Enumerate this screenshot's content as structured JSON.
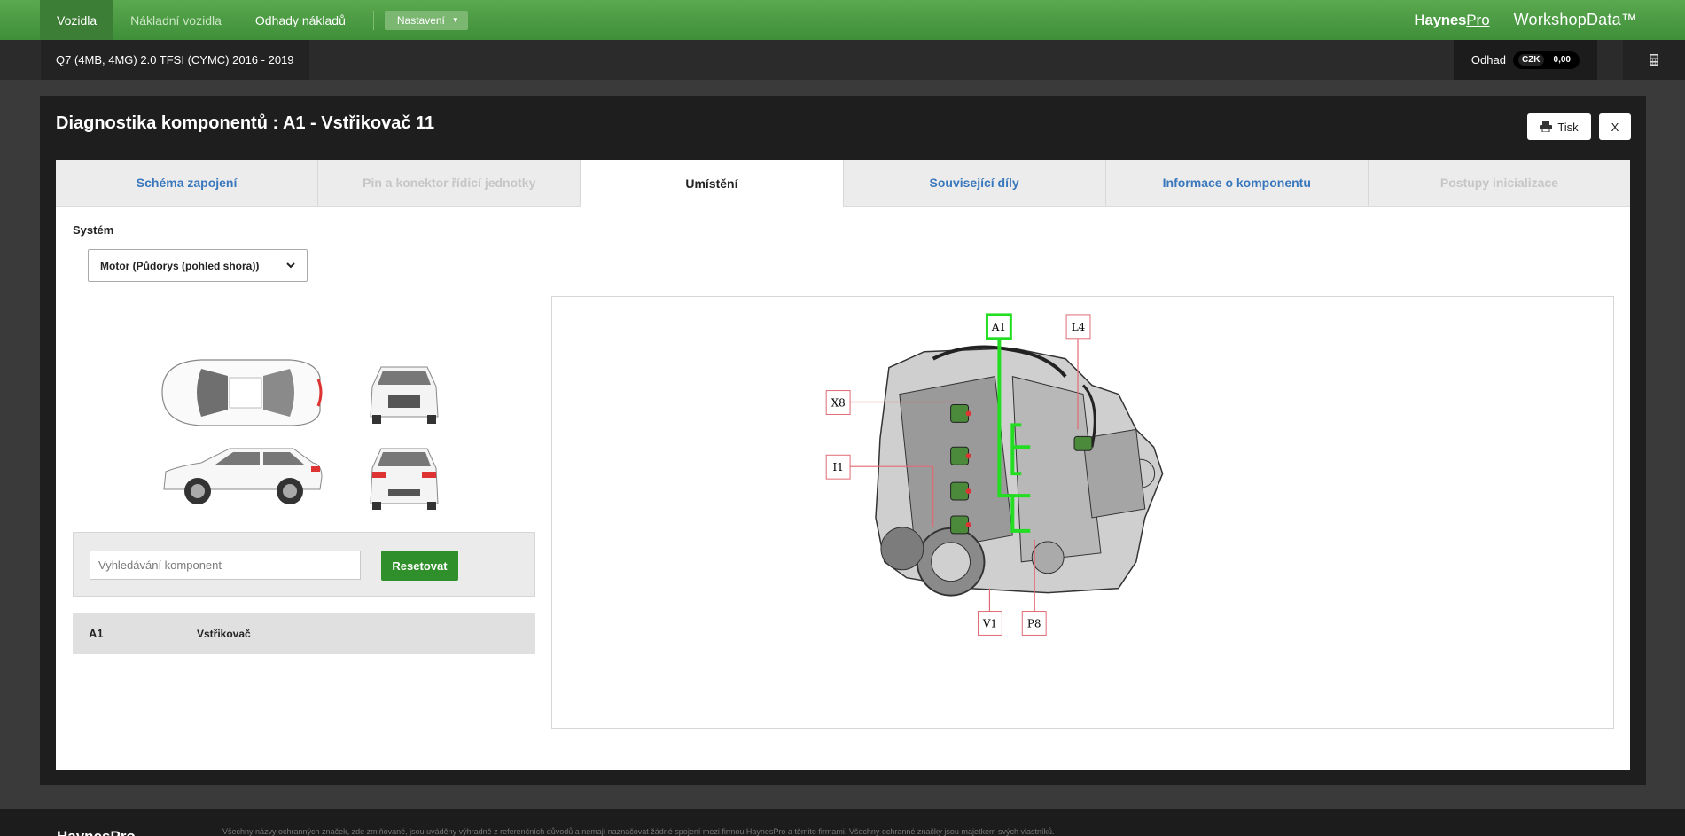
{
  "nav": {
    "items": [
      {
        "label": "Vozidla",
        "state": "active"
      },
      {
        "label": "Nákladní vozidla",
        "state": "disabled"
      },
      {
        "label": "Odhady nákladů",
        "state": "normal"
      }
    ],
    "settings_label": "Nastavení",
    "brand_haynes": "Haynes",
    "brand_pro": "Pro",
    "brand_workshop": "WorkshopData™"
  },
  "vehicle": {
    "title": "Q7 (4MB, 4MG) 2.0 TFSI (CYMC) 2016 - 2019",
    "estimate_label": "Odhad",
    "estimate_currency": "CZK",
    "estimate_value": "0,00"
  },
  "modal": {
    "title": "Diagnostika komponentů : A1 - Vstřikovač 11",
    "print_label": "Tisk",
    "close_label": "X",
    "tabs": [
      {
        "label": "Schéma zapojení",
        "state": "normal"
      },
      {
        "label": "Pin a konektor řídicí jednotky",
        "state": "disabled"
      },
      {
        "label": "Umístění",
        "state": "active"
      },
      {
        "label": "Související díly",
        "state": "normal"
      },
      {
        "label": "Informace o komponentu",
        "state": "normal"
      },
      {
        "label": "Postupy inicializace",
        "state": "disabled"
      }
    ],
    "system_label": "Systém",
    "system_value": "Motor (Půdorys (pohled shora))",
    "search_placeholder": "Vyhledávání komponent",
    "reset_label": "Resetovat",
    "result": {
      "code": "A1",
      "name": "Vstřikovač"
    },
    "diagram_labels": {
      "a1": "A1",
      "l4": "L4",
      "x8": "X8",
      "i1": "I1",
      "v1": "V1",
      "p8": "P8"
    }
  },
  "footer": {
    "logo": "HaynesPro",
    "text": "Všechny názvy ochranných značek, zde zmiňované, jsou uváděny výhradně z referenčních důvodů a nemají naznačovat žádné spojení mezi firmou HaynesPro a těmito firmami. Všechny ochranné značky jsou majetkem svých vlastníků."
  },
  "colors": {
    "nav_green": "#4e9d45",
    "highlight": "#22dd22",
    "callout": "#e0606a",
    "link": "#3a78bd"
  }
}
